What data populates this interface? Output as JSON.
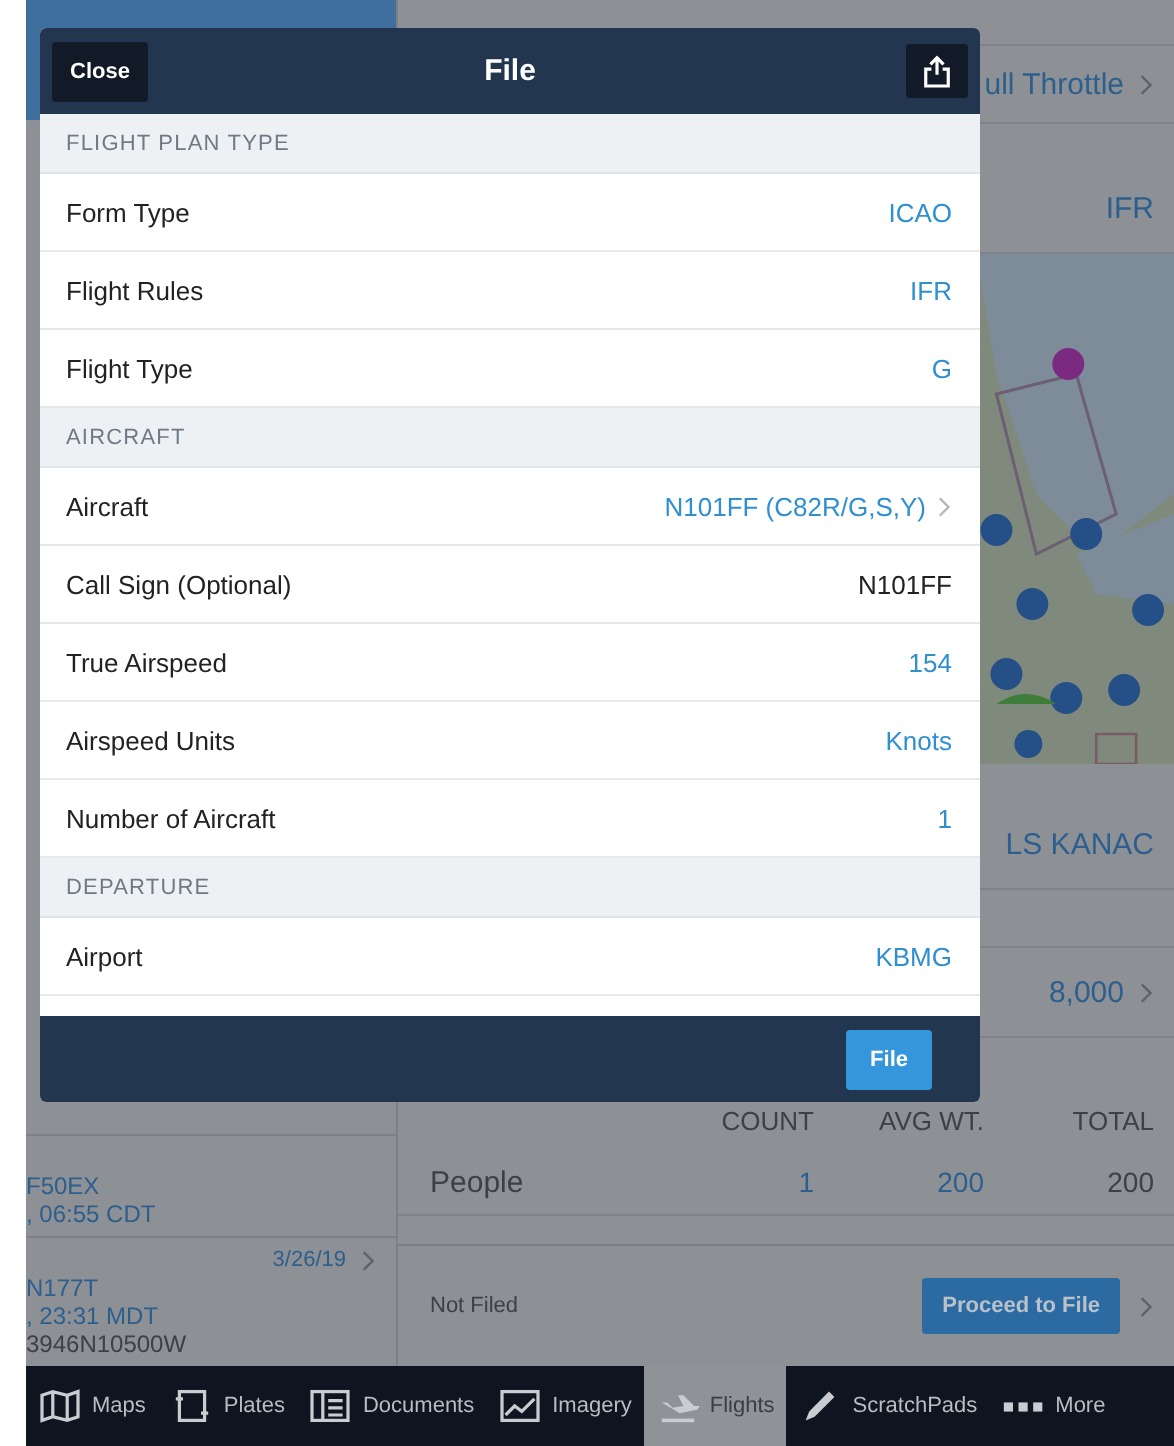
{
  "background": {
    "right_panel": {
      "route_value": "ull Throttle",
      "rules_value": "IFR",
      "approach_value": "LS KANAC",
      "altitude_value": "8,000",
      "table": {
        "columns": [
          "COUNT",
          "AVG WT.",
          "TOTAL"
        ],
        "rows": [
          {
            "label": "People",
            "cells": [
              "1",
              "200",
              "200"
            ]
          }
        ]
      },
      "status": "Not Filed",
      "proceed": "Proceed to File"
    },
    "left_list": [
      {
        "lines": [
          "F50EX",
          ", 06:55 CDT"
        ]
      },
      {
        "date": "3/26/19",
        "lines": [
          "N177T",
          ", 23:31 MDT",
          "3946N10500W"
        ]
      }
    ]
  },
  "modal": {
    "close": "Close",
    "title": "File",
    "submit": "File",
    "sections": [
      {
        "header": "FLIGHT PLAN TYPE",
        "rows": [
          {
            "label": "Form Type",
            "value": "ICAO",
            "kind": "select"
          },
          {
            "label": "Flight Rules",
            "value": "IFR",
            "kind": "select"
          },
          {
            "label": "Flight Type",
            "value": "G",
            "kind": "select"
          }
        ]
      },
      {
        "header": "AIRCRAFT",
        "rows": [
          {
            "label": "Aircraft",
            "value": "N101FF (C82R/G,S,Y)",
            "kind": "nav"
          },
          {
            "label": "Call Sign (Optional)",
            "value": "N101FF",
            "kind": "input"
          },
          {
            "label": "True Airspeed",
            "value": "154",
            "kind": "select"
          },
          {
            "label": "Airspeed Units",
            "value": "Knots",
            "kind": "select"
          },
          {
            "label": "Number of Aircraft",
            "value": "1",
            "kind": "select"
          }
        ]
      },
      {
        "header": "DEPARTURE",
        "rows": [
          {
            "label": "Airport",
            "value": "KBMG",
            "kind": "select"
          }
        ]
      }
    ]
  },
  "tab_bar": [
    {
      "label": "Maps",
      "selected": false
    },
    {
      "label": "Plates",
      "selected": false
    },
    {
      "label": "Documents",
      "selected": false
    },
    {
      "label": "Imagery",
      "selected": false
    },
    {
      "label": "Flights",
      "selected": true
    },
    {
      "label": "ScratchPads",
      "selected": false
    },
    {
      "label": "More",
      "selected": false
    }
  ]
}
